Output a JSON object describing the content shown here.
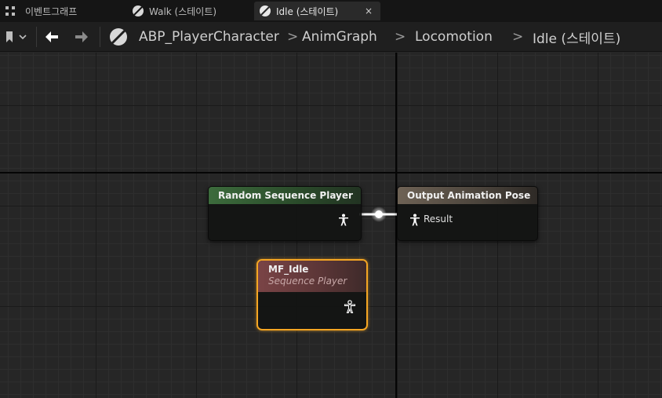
{
  "tabs": [
    {
      "label": "이벤트그래프",
      "icon": "event-graph-icon"
    },
    {
      "label": "Walk (스테이트)",
      "icon": "state-icon"
    },
    {
      "label": "Idle (스테이트)",
      "icon": "state-icon",
      "active": true,
      "close": "×"
    }
  ],
  "breadcrumb": {
    "items": [
      "ABP_PlayerCharacter",
      "AnimGraph",
      "Locomotion",
      "Idle (스테이트)"
    ],
    "separator": ">"
  },
  "nodes": {
    "random_sequence_player": {
      "title": "Random Sequence Player",
      "header_color": "#3c6b3c"
    },
    "output_pose": {
      "title": "Output Animation Pose",
      "pin_label": "Result",
      "header_color": "#6e6255"
    },
    "mf_idle": {
      "title": "MF_Idle",
      "subtitle": "Sequence Player",
      "header_color": "#7a4446"
    }
  },
  "colors": {
    "selection": "#f5a623",
    "wire": "#ffffff"
  }
}
